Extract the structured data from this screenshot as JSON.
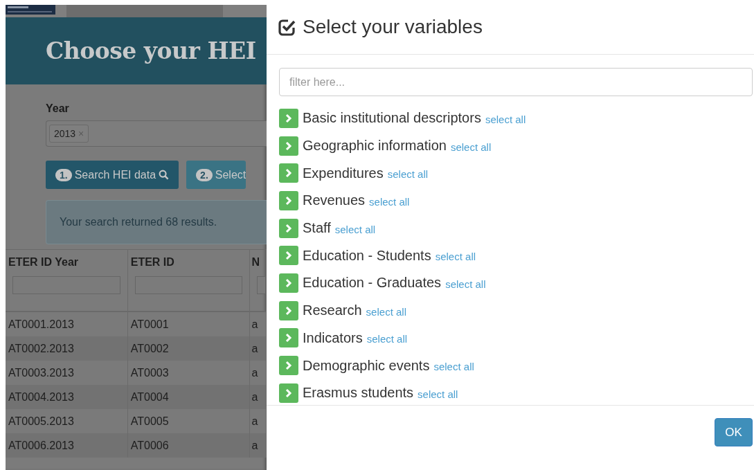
{
  "background_page": {
    "header_title": "Choose your HEI",
    "year_filter": {
      "label": "Year",
      "tags": [
        {
          "label": "2013",
          "remove": "×"
        }
      ]
    },
    "buttons": [
      {
        "number": "1.",
        "label": "Search HEI data",
        "kind": "search"
      },
      {
        "number": "2.",
        "label": "Select",
        "kind": "select"
      }
    ],
    "alert": "Your search returned 68 results.",
    "table": {
      "columns": [
        "ETER ID Year",
        "ETER ID",
        "N"
      ],
      "rows": [
        [
          "AT0001.2013",
          "AT0001",
          "a"
        ],
        [
          "AT0002.2013",
          "AT0002",
          "a"
        ],
        [
          "AT0003.2013",
          "AT0003",
          "a"
        ],
        [
          "AT0004.2013",
          "AT0004",
          "a"
        ],
        [
          "AT0005.2013",
          "AT0005",
          "a"
        ],
        [
          "AT0006.2013",
          "AT0006",
          "a"
        ]
      ]
    }
  },
  "modal": {
    "title": "Select your variables",
    "filter": {
      "placeholder": "filter here..."
    },
    "groups": [
      {
        "label": "Basic institutional descriptors",
        "action": "select all"
      },
      {
        "label": "Geographic information",
        "action": "select all"
      },
      {
        "label": "Expenditures",
        "action": "select all"
      },
      {
        "label": "Revenues",
        "action": "select all"
      },
      {
        "label": "Staff",
        "action": "select all"
      },
      {
        "label": "Education - Students",
        "action": "select all"
      },
      {
        "label": "Education - Graduates",
        "action": "select all"
      },
      {
        "label": "Research",
        "action": "select all"
      },
      {
        "label": "Indicators",
        "action": "select all"
      },
      {
        "label": "Demographic events",
        "action": "select all"
      },
      {
        "label": "Erasmus students",
        "action": "select all"
      }
    ],
    "buttons": [
      "OK"
    ]
  }
}
